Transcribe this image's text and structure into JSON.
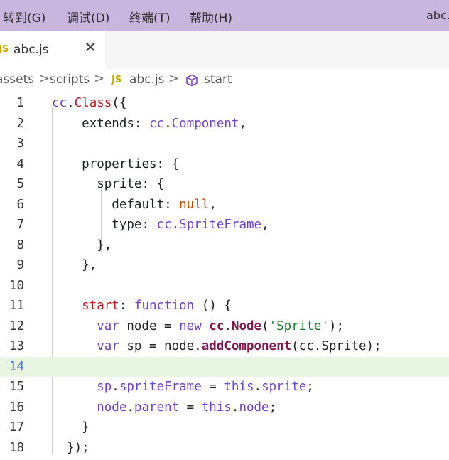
{
  "menubar": {
    "items": [
      "转到(G)",
      "调试(D)",
      "终端(T)",
      "帮助(H)"
    ],
    "window_title": "abc.js"
  },
  "tab": {
    "badge": "JS",
    "label": "abc.js",
    "close": "✕"
  },
  "breadcrumb": {
    "items": [
      "assets",
      "scripts",
      "abc.js",
      "start"
    ],
    "file_badge": "JS",
    "separator": ">"
  },
  "editor": {
    "current_line": 14,
    "line_numbers": [
      "1",
      "2",
      "3",
      "4",
      "5",
      "6",
      "7",
      "8",
      "9",
      "10",
      "11",
      "12",
      "13",
      "14",
      "15",
      "16",
      "17",
      "18"
    ]
  }
}
